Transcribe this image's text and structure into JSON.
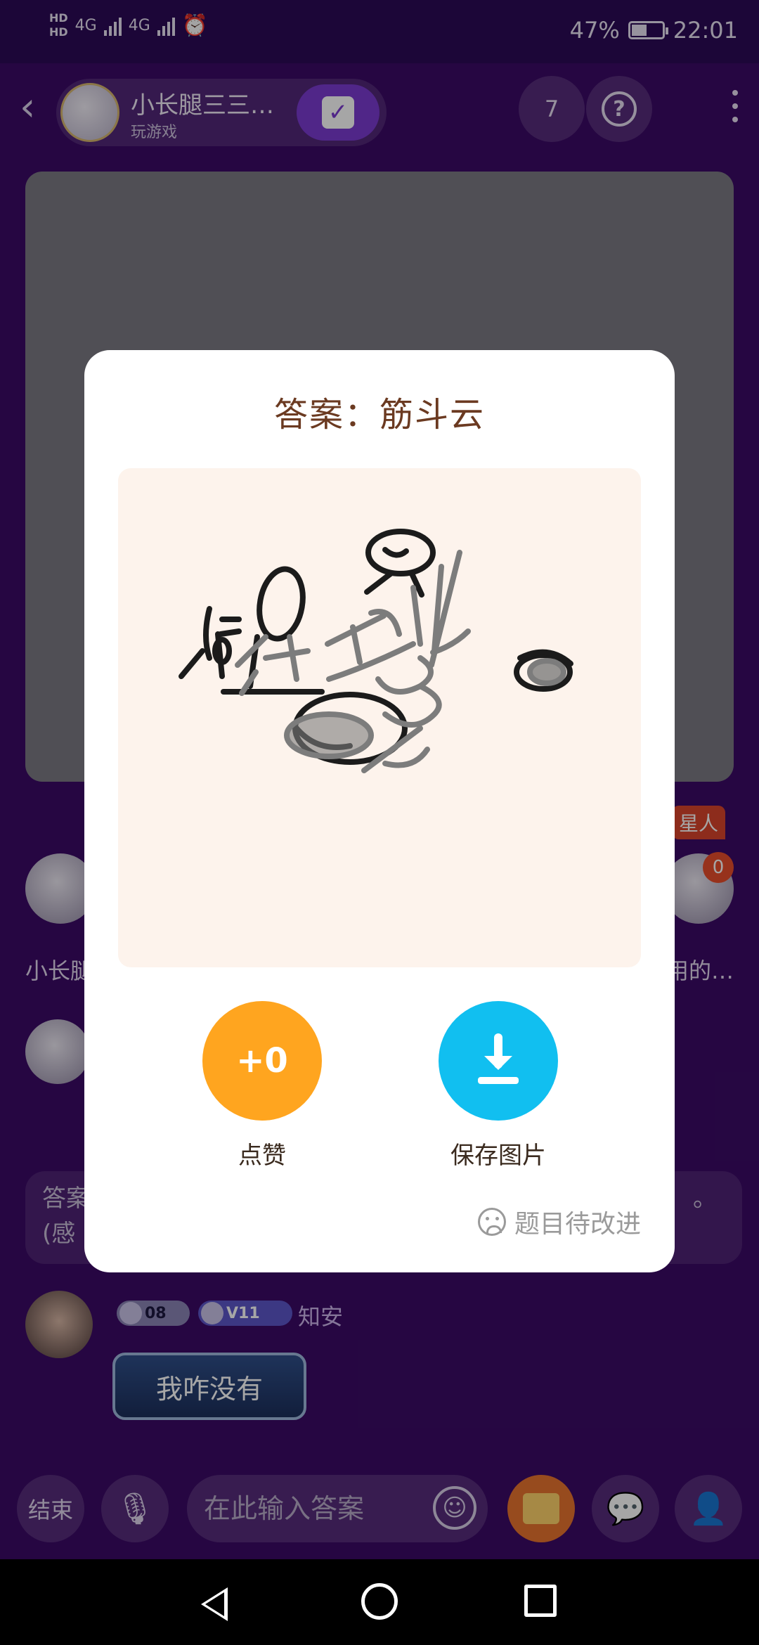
{
  "status_bar": {
    "hd1": "HD",
    "hd2": "HD",
    "net1": "4G",
    "net2": "4G",
    "battery": "47%",
    "time": "22:01"
  },
  "header": {
    "host_name": "小长腿三三…",
    "host_status": "玩游戏",
    "audience_count": "7"
  },
  "seats": [
    {
      "name": "小长腿"
    },
    {
      "name": "用的…",
      "tag": "星人",
      "score": "0"
    }
  ],
  "chat": {
    "hint_line1": "答案",
    "hint_line2": "(感",
    "hint_tail": "。",
    "badge1": "08",
    "badge2": "V11",
    "username": "知安",
    "message": "我咋没有"
  },
  "input": {
    "placeholder": "在此输入答案",
    "end_label": "结束"
  },
  "dialog": {
    "title": "答案：筋斗云",
    "like_count": "+0",
    "like_label": "点赞",
    "save_label": "保存图片",
    "feedback_label": "题目待改进"
  },
  "colors": {
    "background": "#3b0a66",
    "like": "#ffa51f",
    "save": "#11bff0",
    "title": "#6b3a21",
    "canvas": "#fdf3ec"
  }
}
